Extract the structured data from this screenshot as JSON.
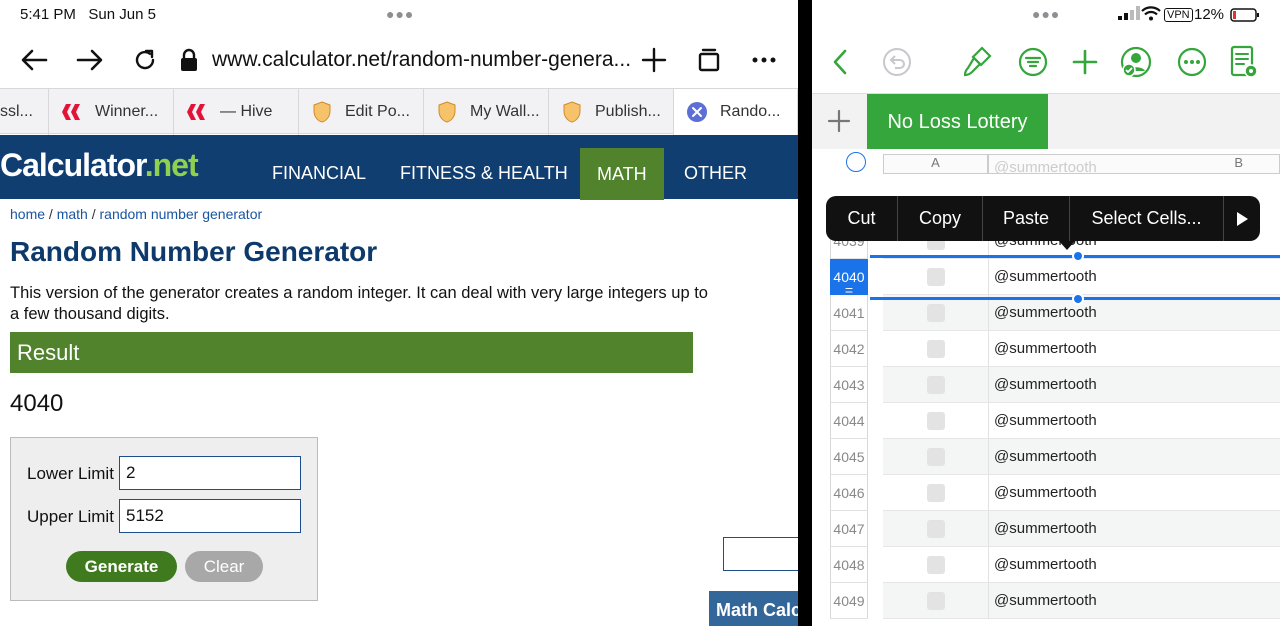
{
  "status": {
    "time": "5:41 PM",
    "date": "Sun Jun 5",
    "battery": "12%",
    "vpn": "VPN"
  },
  "browser": {
    "url": "www.calculator.net/random-number-genera...",
    "tabs": [
      {
        "label": "ssl...",
        "icon": "tab-icon"
      },
      {
        "label": "Winner...",
        "icon": "hive-icon"
      },
      {
        "label": "— Hive",
        "icon": "hive-icon"
      },
      {
        "label": "Edit Po...",
        "icon": "shield-icon"
      },
      {
        "label": "My Wall...",
        "icon": "shield-icon"
      },
      {
        "label": "Publish...",
        "icon": "shield-icon"
      },
      {
        "label": "Rando...",
        "icon": "close-icon"
      }
    ]
  },
  "site": {
    "logo_main": "Calculator",
    "logo_suffix": ".net",
    "menu": [
      "FINANCIAL",
      "FITNESS & HEALTH",
      "MATH",
      "OTHER"
    ],
    "breadcrumb": {
      "home": "home",
      "math": "math",
      "current": "random number generator",
      "sep": " / "
    },
    "title": "Random Number Generator",
    "description": "This version of the generator creates a random integer. It can deal with very large integers up to a few thousand digits.",
    "result_label": "Result",
    "result_value": "4040",
    "form": {
      "lower_label": "Lower Limit",
      "lower_value": "2",
      "upper_label": "Upper Limit",
      "upper_value": "5152",
      "generate": "Generate",
      "clear": "Clear"
    },
    "side_banner": "Math Calc"
  },
  "numbers": {
    "sheet_tab": "No Loss Lottery",
    "columns": [
      "A",
      "B"
    ],
    "ghost_text": "@summertooth",
    "context_menu": [
      "Cut",
      "Copy",
      "Paste",
      "Select Cells..."
    ],
    "rows": [
      {
        "num": "4039",
        "value": "@summertooth"
      },
      {
        "num": "4040",
        "value": "@summertooth"
      },
      {
        "num": "4041",
        "value": "@summertooth"
      },
      {
        "num": "4042",
        "value": "@summertooth"
      },
      {
        "num": "4043",
        "value": "@summertooth"
      },
      {
        "num": "4044",
        "value": "@summertooth"
      },
      {
        "num": "4045",
        "value": "@summertooth"
      },
      {
        "num": "4046",
        "value": "@summertooth"
      },
      {
        "num": "4047",
        "value": "@summertooth"
      },
      {
        "num": "4048",
        "value": "@summertooth"
      },
      {
        "num": "4049",
        "value": "@summertooth"
      }
    ],
    "selected_row": "4040"
  },
  "colors": {
    "site_blue": "#103e71",
    "site_green": "#51832d",
    "numbers_green": "#34a63b",
    "selection_blue": "#1a73e8"
  }
}
